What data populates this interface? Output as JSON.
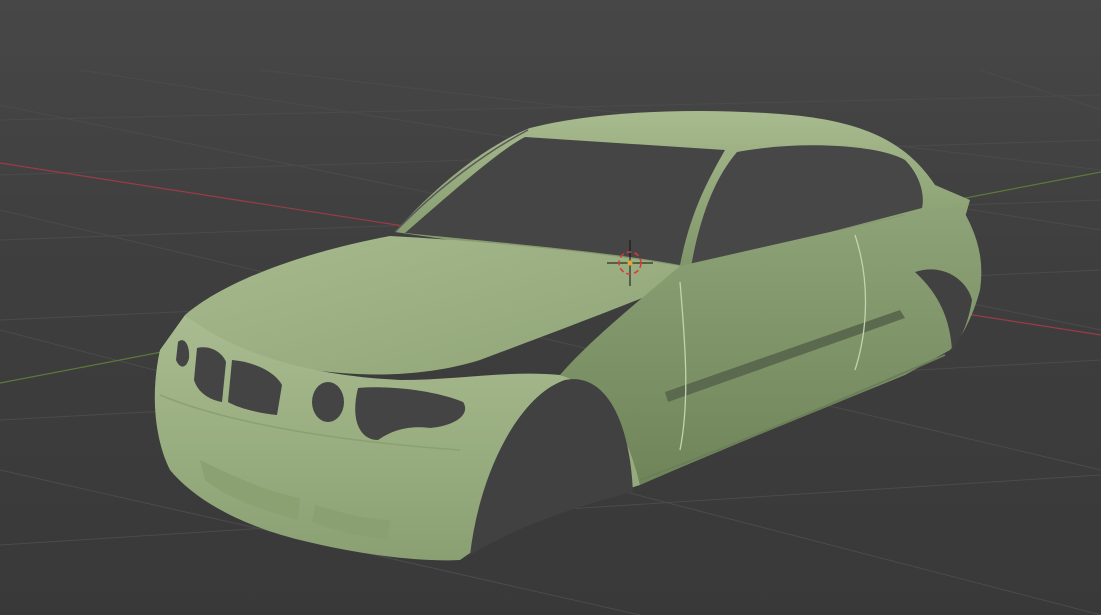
{
  "viewport": {
    "background_color": "#3d3d3d",
    "grid_color": "#4a4a4a",
    "x_axis_color": "#9a3c46",
    "y_axis_color": "#5b7a3a",
    "model_color": "#a3b88a",
    "opening_color": "#3f3f3f",
    "cursor_icon": "3d-cursor-icon",
    "origin_color": "#f0a030"
  }
}
